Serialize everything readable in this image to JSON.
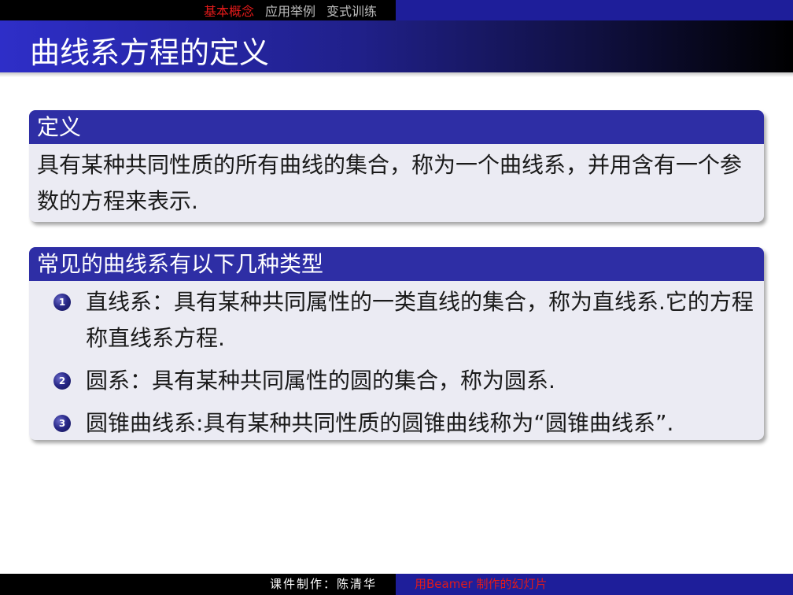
{
  "nav": {
    "items": [
      {
        "label": "基本概念",
        "active": true
      },
      {
        "label": "应用举例",
        "active": false
      },
      {
        "label": "变式训练",
        "active": false
      }
    ]
  },
  "frame": {
    "title": "曲线系方程的定义"
  },
  "definition_block": {
    "title": "定义",
    "body": "具有某种共同性质的所有曲线的集合，称为一个曲线系，并用含有一个参数的方程来表示."
  },
  "types_block": {
    "title": "常见的曲线系有以下几种类型",
    "items": [
      {
        "number": "1",
        "text": "直线系：具有某种共同属性的一类直线的集合，称为直线系.它的方程称直线系方程."
      },
      {
        "number": "2",
        "text": "圆系：具有某种共同属性的圆的集合，称为圆系."
      },
      {
        "number": "3",
        "text": "圆锥曲线系:具有某种共同性质的圆锥曲线称为“圆锥曲线系”."
      }
    ]
  },
  "footer": {
    "author": "课件制作：陈清华",
    "note": "用Beamer 制作的幻灯片"
  },
  "colors": {
    "structure_blue": "#2e2ea5",
    "footer_blue": "#1e1e9a",
    "alert_red": "#e21a1a",
    "block_body_bg": "#ebebf3"
  }
}
